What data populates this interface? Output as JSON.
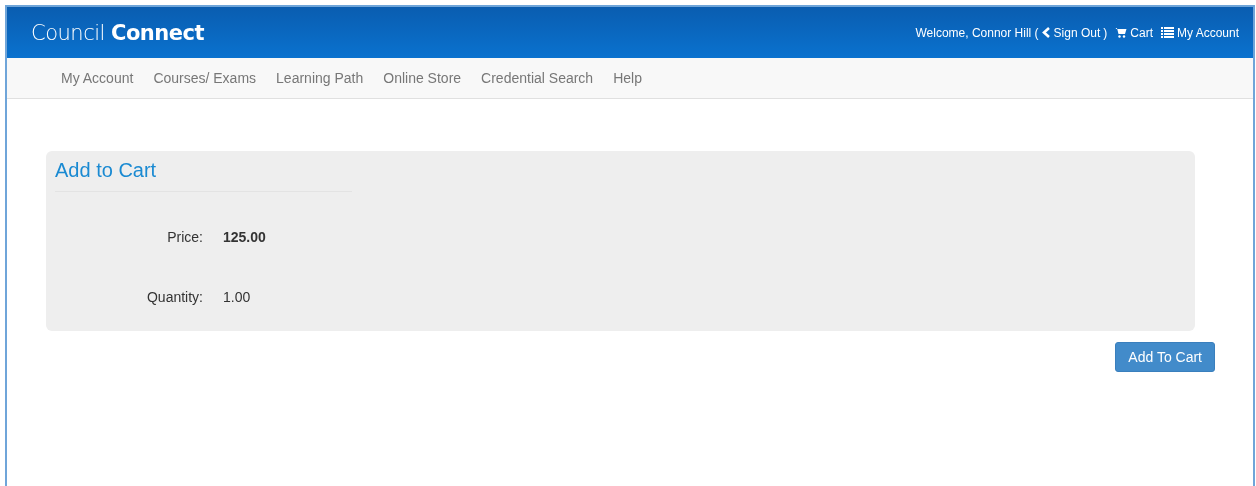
{
  "header": {
    "logo": {
      "light": "Council",
      "bold": "Connect"
    },
    "welcome": "Welcome, Connor Hill (",
    "sign_out": "Sign Out",
    "close_paren": ")",
    "cart": "Cart",
    "account": "My Account"
  },
  "nav": [
    {
      "label": "My Account"
    },
    {
      "label": "Courses/ Exams"
    },
    {
      "label": "Learning Path"
    },
    {
      "label": "Online Store"
    },
    {
      "label": "Credential Search"
    },
    {
      "label": "Help"
    }
  ],
  "panel": {
    "title": "Add to Cart",
    "fields": [
      {
        "label": "Price:",
        "value": "125.00",
        "bold": true
      },
      {
        "label": "Quantity:",
        "value": "1.00",
        "bold": false
      }
    ]
  },
  "button": "Add To Cart"
}
